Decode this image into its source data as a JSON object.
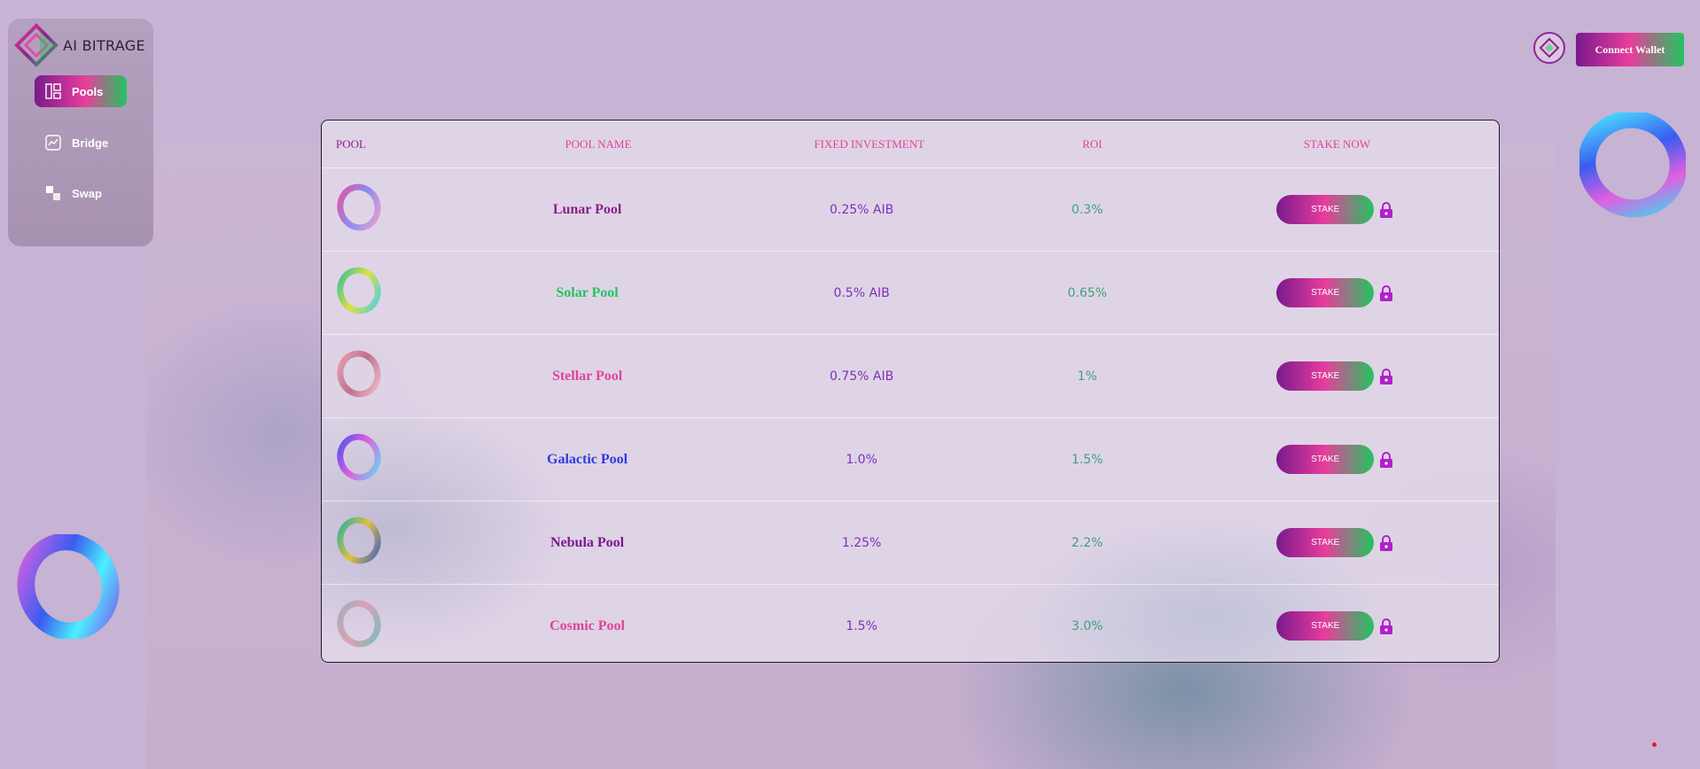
{
  "app": {
    "logo_text": "AI BITRAGE"
  },
  "sidebar": {
    "items": [
      {
        "label": "Pools",
        "icon": "layout-icon",
        "active": true
      },
      {
        "label": "Bridge",
        "icon": "chart-icon",
        "active": false
      },
      {
        "label": "Swap",
        "icon": "swap-icon",
        "active": false
      }
    ]
  },
  "header": {
    "connect_label": "Connect Wallet"
  },
  "table": {
    "columns": [
      "POOL",
      "POOL NAME",
      "FIXED INVESTMENT",
      "ROI",
      "STAKE NOW"
    ],
    "rows": [
      {
        "name": "Lunar Pool",
        "investment": "0.25% AIB",
        "roi": "0.3%",
        "stake": "STAKE",
        "name_color": "#8e1f8a",
        "ring": "pink"
      },
      {
        "name": "Solar Pool",
        "investment": "0.5% AIB",
        "roi": "0.65%",
        "stake": "STAKE",
        "name_color": "#22c55e",
        "ring": "green"
      },
      {
        "name": "Stellar Pool",
        "investment": "0.75% AIB",
        "roi": "1%",
        "stake": "STAKE",
        "name_color": "#e0439c",
        "ring": "rose"
      },
      {
        "name": "Galactic Pool",
        "investment": "1.0%",
        "roi": "1.5%",
        "stake": "STAKE",
        "name_color": "#2d3be0",
        "ring": "blue"
      },
      {
        "name": "Nebula Pool",
        "investment": "1.25%",
        "roi": "2.2%",
        "stake": "STAKE",
        "name_color": "#7a1a8c",
        "ring": "teal"
      },
      {
        "name": "Cosmic Pool",
        "investment": "1.5%",
        "roi": "3.0%",
        "stake": "STAKE",
        "name_color": "#e0439c",
        "ring": "silver"
      }
    ]
  },
  "colors": {
    "accent_purple": "#7a1a8c",
    "accent_pink": "#e83d9c",
    "accent_green": "#22c55e",
    "lock": "#b020c8"
  }
}
